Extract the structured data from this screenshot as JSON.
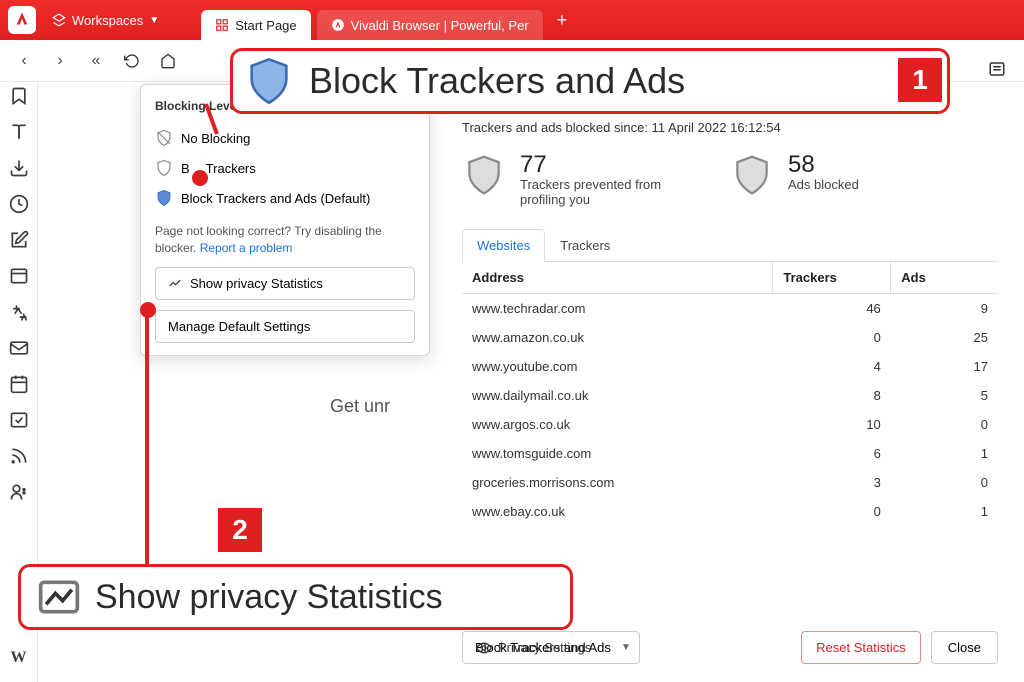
{
  "top": {
    "workspaces": "Workspaces",
    "tab1": "Start Page",
    "tab2": "Vivaldi Browser | Powerful, Per"
  },
  "popup": {
    "heading": "Blocking Level on",
    "opt_none": "No Blocking",
    "opt_trackers_prefix": "B",
    "opt_trackers_suffix": "Trackers",
    "opt_both": "Block Trackers and Ads (Default)",
    "help1": "Page not looking correct? Try disabling the blocker. ",
    "help_link": "Report a problem",
    "show_stats": "Show privacy Statistics",
    "manage": "Manage Default Settings"
  },
  "callout1_text": "Block Trackers and Ads",
  "callout2_text": "Show privacy Statistics",
  "badge1": "1",
  "badge2": "2",
  "since": "Trackers and ads blocked since: 11 April 2022 16:12:54",
  "stat1": {
    "num": "77",
    "lbl": "Trackers prevented from profiling you"
  },
  "stat2": {
    "num": "58",
    "lbl": "Ads blocked"
  },
  "tabs": {
    "websites": "Websites",
    "trackers": "Trackers"
  },
  "table": {
    "h1": "Address",
    "h2": "Trackers",
    "h3": "Ads",
    "rows": [
      {
        "a": "www.techradar.com",
        "t": "46",
        "d": "9"
      },
      {
        "a": "www.amazon.co.uk",
        "t": "0",
        "d": "25"
      },
      {
        "a": "www.youtube.com",
        "t": "4",
        "d": "17"
      },
      {
        "a": "www.dailymail.co.uk",
        "t": "8",
        "d": "5"
      },
      {
        "a": "www.argos.co.uk",
        "t": "10",
        "d": "0"
      },
      {
        "a": "www.tomsguide.com",
        "t": "6",
        "d": "1"
      },
      {
        "a": "groceries.morrisons.com",
        "t": "3",
        "d": "0"
      },
      {
        "a": "www.ebay.co.uk",
        "t": "0",
        "d": "1"
      }
    ]
  },
  "footer": {
    "dd": "Block Trackers and Ads",
    "privacy": "Privacy Settings",
    "reset": "Reset Statistics",
    "close": "Close"
  },
  "getunr": "Get unr"
}
